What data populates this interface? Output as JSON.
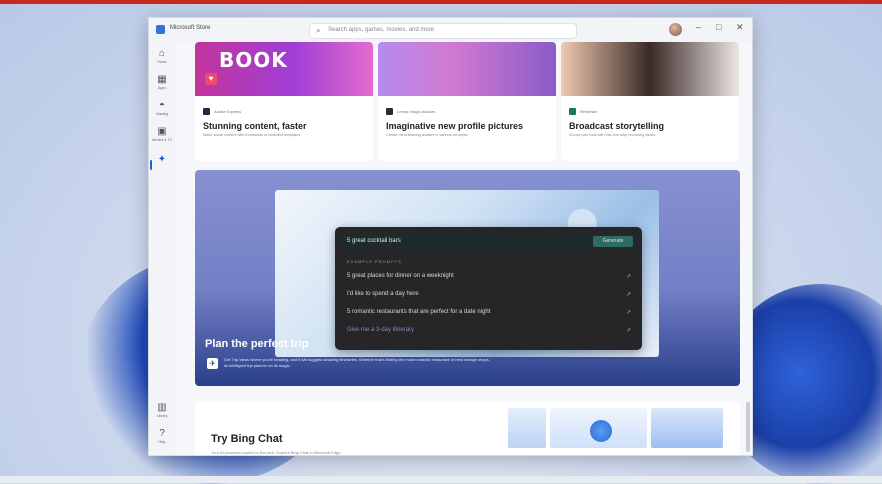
{
  "app": {
    "name": "Microsoft Store"
  },
  "search": {
    "placeholder": "Search apps, games, movies, and more"
  },
  "window_controls": {
    "minimize": "–",
    "maximize": "□",
    "close": "✕"
  },
  "sidebar": {
    "items": [
      {
        "label": "Home",
        "icon": "home-icon",
        "glyph": "⌂"
      },
      {
        "label": "Apps",
        "icon": "apps-icon",
        "glyph": "▦"
      },
      {
        "label": "Gaming",
        "icon": "gaming-icon",
        "glyph": "◓"
      },
      {
        "label": "Movies & TV",
        "icon": "movies-icon",
        "glyph": "▣"
      },
      {
        "label": "",
        "icon": "ai-hub-icon",
        "glyph": "✦"
      }
    ],
    "bottom": [
      {
        "label": "Library",
        "icon": "library-icon",
        "glyph": "▥"
      },
      {
        "label": "Help",
        "icon": "help-icon",
        "glyph": "?"
      }
    ]
  },
  "cards": [
    {
      "publisher": "Adobe Express",
      "title": "Stunning content, faster",
      "desc": "Make social content with thousands of beautiful templates",
      "art_word": "BOOK"
    },
    {
      "publisher": "Lensa: Magic Avatars",
      "title": "Imaginative new profile pictures",
      "desc": "Create mind-blowing avatars in various art styles"
    },
    {
      "publisher": "Restream",
      "title": "Broadcast storytelling",
      "desc": "Sound your best with this one-stop recording studio"
    }
  ],
  "hero": {
    "title": "Plan the perfect trip",
    "desc": "Get Trip Ideas where you're heading, and it will suggest amazing itineraries. Whether that's finding the most romantic restaurant or best vintage shops, its intelligent trip planner do its magic."
  },
  "bing_panel": {
    "input": "5 great cocktail bars",
    "generate": "Generate",
    "label": "EXAMPLE PROMPTS",
    "prompts": [
      "5 great places for dinner on a weeknight",
      "I'd like to spend a day here",
      "5 romantic restaurants that are perfect for a date night",
      "Give me a 3-day itinerary"
    ]
  },
  "bing_chat": {
    "title": "Try Bing Chat",
    "sub": "Your AI-powered copilot for the web. Explore Bing Chat in Microsoft Edge."
  },
  "colors": {
    "accent": "#2a5bd7",
    "generate_button": "#2f6a62"
  }
}
